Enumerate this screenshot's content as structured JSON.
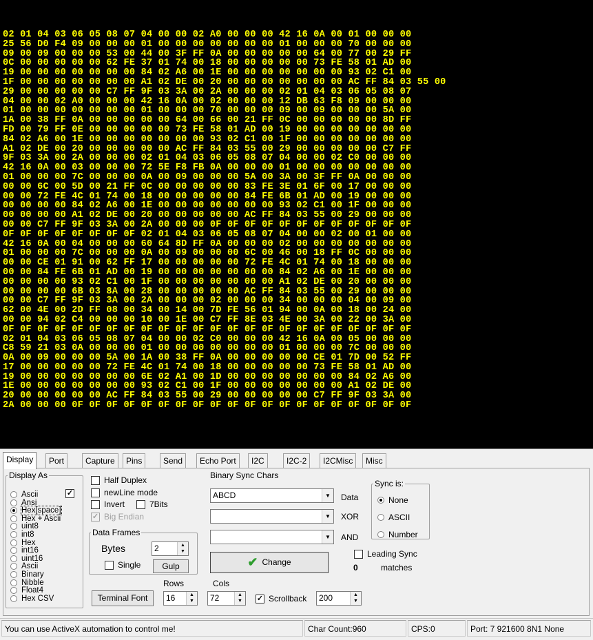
{
  "terminal": {
    "lines": [
      "02 01 04 03 06 05 08 07 04 00 00 02 A0 00 00 00 42 16 0A 00 01 00 00 00",
      "25 56 D0 F4 09 00 00 00 01 00 00 00 00 00 00 00 01 00 00 00 70 00 00 00",
      "09 00 09 00 00 00 53 00 44 00 3F FF 0A 00 00 00 00 00 64 00 77 00 29 FF",
      "0C 00 00 00 00 00 62 FE 37 01 74 00 18 00 00 00 00 00 73 FE 58 01 AD 00",
      "19 00 00 00 00 00 00 00 84 02 A6 00 1E 00 00 00 00 00 00 00 93 02 C1 00",
      "1F 00 00 00 00 00 00 00 A1 02 DE 00 20 00 00 00 00 00 00 00 AC FF 84 03 55 00",
      "29 00 00 00 00 00 C7 FF 9F 03 3A 00 2A 00 00 00 02 01 04 03 06 05 08 07",
      "04 00 00 02 A0 00 00 00 42 16 0A 00 02 00 00 00 12 DB 63 F8 09 00 00 00",
      "01 00 00 00 00 00 00 00 01 00 00 00 70 00 00 00 09 00 09 00 00 00 5A 00",
      "1A 00 38 FF 0A 00 00 00 00 00 64 00 66 00 21 FF 0C 00 00 00 00 00 8D FF",
      "FD 00 79 FF 0E 00 00 00 00 00 73 FE 58 01 AD 00 19 00 00 00 00 00 00 00",
      "84 02 A6 00 1E 00 00 00 00 00 00 00 93 02 C1 00 1F 00 00 00 00 00 00 00",
      "A1 02 DE 00 20 00 00 00 00 00 AC FF 84 03 55 00 29 00 00 00 00 00 C7 FF",
      "9F 03 3A 00 2A 00 00 00 02 01 04 03 06 05 08 07 04 00 00 02 C0 00 00 00",
      "42 16 0A 00 03 00 00 00 72 5E F8 FB 0A 00 00 00 01 00 00 00 00 00 00 00",
      "01 00 00 00 7C 00 00 00 0A 00 09 00 00 00 5A 00 3A 00 3F FF 0A 00 00 00",
      "00 00 6C 00 5D 00 21 FF 0C 00 00 00 00 00 83 FE 3E 01 6F 00 17 00 00 00",
      "00 00 72 FE 4C 01 74 00 18 00 00 00 00 00 84 FE 6B 01 AD 00 19 00 00 00",
      "00 00 00 00 84 02 A6 00 1E 00 00 00 00 00 00 00 93 02 C1 00 1F 00 00 00",
      "00 00 00 00 A1 02 DE 00 20 00 00 00 00 00 AC FF 84 03 55 00 29 00 00 00",
      "00 00 C7 FF 9F 03 3A 00 2A 00 00 00 0F 0F 0F 0F 0F 0F 0F 0F 0F 0F 0F 0F",
      "0F 0F 0F 0F 0F 0F 0F 0F 02 01 04 03 06 05 08 07 04 00 00 02 00 01 00 00",
      "42 16 0A 00 04 00 00 00 60 64 8D FF 0A 00 00 00 02 00 00 00 00 00 00 00",
      "01 00 00 00 7C 00 00 00 0A 00 09 00 00 00 6C 00 46 00 18 FF 0C 00 00 00",
      "00 00 CE 01 91 00 62 FF 17 00 00 00 00 00 72 FE 4C 01 74 00 18 00 00 00",
      "00 00 84 FE 6B 01 AD 00 19 00 00 00 00 00 00 00 84 02 A6 00 1E 00 00 00",
      "00 00 00 00 93 02 C1 00 1F 00 00 00 00 00 00 00 A1 02 DE 00 20 00 00 00",
      "00 00 00 00 6B 03 8A 00 28 00 00 00 00 00 AC FF 84 03 55 00 29 00 00 00",
      "00 00 C7 FF 9F 03 3A 00 2A 00 00 00 02 00 00 00 34 00 00 00 04 00 09 00",
      "62 00 4E 00 2D FF 08 00 34 00 14 00 7D FE 56 01 94 00 0A 00 18 00 24 00",
      "00 00 94 02 C4 00 00 00 10 00 1E 00 C7 FF 8E 03 4E 00 3A 00 22 00 3A 00",
      "0F 0F 0F 0F 0F 0F 0F 0F 0F 0F 0F 0F 0F 0F 0F 0F 0F 0F 0F 0F 0F 0F 0F 0F",
      "02 01 04 03 06 05 08 07 04 00 00 02 C0 00 00 00 42 16 0A 00 05 00 00 00",
      "C8 59 21 03 0A 00 00 00 01 00 00 00 00 00 00 00 01 00 00 00 7C 00 00 00",
      "0A 00 09 00 00 00 5A 00 1A 00 38 FF 0A 00 00 00 00 00 CE 01 7D 00 52 FF",
      "17 00 00 00 00 00 72 FE 4C 01 74 00 18 00 00 00 00 00 73 FE 58 01 AD 00",
      "19 00 00 00 00 00 00 00 6E 02 A1 00 1D 00 00 00 00 00 00 00 84 02 A6 00",
      "1E 00 00 00 00 00 00 00 93 02 C1 00 1F 00 00 00 00 00 00 00 A1 02 DE 00",
      "20 00 00 00 00 00 AC FF 84 03 55 00 29 00 00 00 00 00 C7 FF 9F 03 3A 00",
      "2A 00 00 00 0F 0F 0F 0F 0F 0F 0F 0F 0F 0F 0F 0F 0F 0F 0F 0F 0F 0F 0F 0F"
    ]
  },
  "tabs": [
    "Display",
    "Port",
    "Capture",
    "Pins",
    "Send",
    "Echo Port",
    "I2C",
    "I2C-2",
    "I2CMisc",
    "Misc"
  ],
  "display_as": {
    "legend": "Display As",
    "options": [
      "Ascii",
      "Ansi",
      "Hex[space]",
      "Hex + Ascii",
      "uint8",
      "int8",
      "Hex",
      "int16",
      "uint16",
      "Ascii",
      "Binary",
      "Nibble",
      "Float4",
      "Hex CSV"
    ],
    "selected_index": 2,
    "checkbox_checked": true
  },
  "options": {
    "half_duplex": "Half Duplex",
    "newline_mode": "newLine mode",
    "invert": "Invert",
    "seven_bits": "7Bits",
    "big_endian": "Big Endian"
  },
  "data_frames": {
    "legend": "Data Frames",
    "bytes_label": "Bytes",
    "bytes_value": "2",
    "single_label": "Single",
    "gulp_label": "Gulp"
  },
  "binary_sync": {
    "legend": "Binary Sync Chars",
    "data_value": "ABCD",
    "xor_value": "",
    "and_value": "",
    "data_label": "Data",
    "xor_label": "XOR",
    "and_label": "AND",
    "change_label": "Change"
  },
  "sync_is": {
    "legend": "Sync is:",
    "options": [
      "None",
      "ASCII",
      "Number"
    ],
    "selected_index": 0
  },
  "leading_sync": {
    "label": "Leading Sync",
    "count": "0",
    "matches_label": "matches"
  },
  "terminal_controls": {
    "font_button": "Terminal Font",
    "rows_label": "Rows",
    "rows_value": "16",
    "cols_label": "Cols",
    "cols_value": "72",
    "scrollback_label": "Scrollback",
    "scrollback_checked": true,
    "scrollback_value": "200"
  },
  "status": {
    "message": "You can use ActiveX automation to control me!",
    "char_count": "Char Count:960",
    "cps": "CPS:0",
    "port": "Port: 7 921600 8N1 None"
  }
}
